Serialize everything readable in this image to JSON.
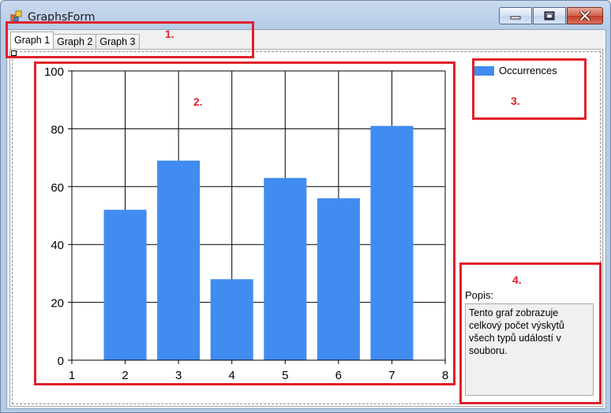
{
  "window": {
    "title": "GraphsForm"
  },
  "tabs": [
    {
      "label": "Graph 1",
      "active": true
    },
    {
      "label": "Graph 2",
      "active": false
    },
    {
      "label": "Graph 3",
      "active": false
    }
  ],
  "legend": {
    "label": "Occurrences",
    "color": "#418cf0"
  },
  "description": {
    "label": "Popis:",
    "text": "Tento graf zobrazuje\ncelkový počet výskytů\nvšech typů událostí v\nsouboru."
  },
  "annotations": [
    "1.",
    "2.",
    "3.",
    "4."
  ],
  "chart_data": {
    "type": "bar",
    "x": [
      2,
      3,
      4,
      5,
      6,
      7
    ],
    "values": [
      52,
      69,
      28,
      63,
      56,
      81
    ],
    "xlim": [
      1,
      8
    ],
    "ylim": [
      0,
      100
    ],
    "xticks": [
      1,
      2,
      3,
      4,
      5,
      6,
      7,
      8
    ],
    "yticks": [
      0,
      20,
      40,
      60,
      80,
      100
    ],
    "grid": true,
    "legend_position": "top-right",
    "color": "#418cf0"
  }
}
